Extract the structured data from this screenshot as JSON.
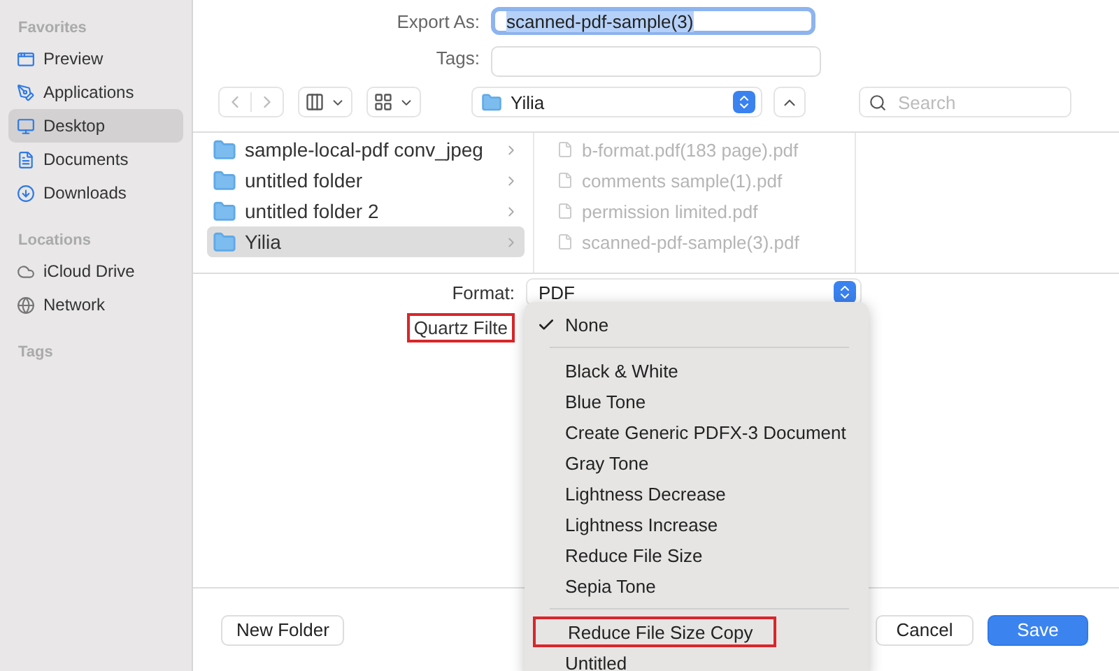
{
  "sidebar": {
    "sections": [
      {
        "heading": "Favorites",
        "items": [
          {
            "label": "Preview",
            "selected": false
          },
          {
            "label": "Applications",
            "selected": false
          },
          {
            "label": "Desktop",
            "selected": true
          },
          {
            "label": "Documents",
            "selected": false
          },
          {
            "label": "Downloads",
            "selected": false
          }
        ]
      },
      {
        "heading": "Locations",
        "items": [
          {
            "label": "iCloud Drive",
            "selected": false
          },
          {
            "label": "Network",
            "selected": false
          }
        ]
      },
      {
        "heading": "Tags"
      }
    ]
  },
  "export_as": {
    "label": "Export As:",
    "value": "scanned-pdf-sample(3)"
  },
  "tags": {
    "label": "Tags:"
  },
  "toolbar": {
    "location": "Yilia",
    "search_placeholder": "Search"
  },
  "browser": {
    "column_1": [
      {
        "name": "sample-local-pdf conv_jpeg",
        "selected": false
      },
      {
        "name": "untitled folder",
        "selected": false
      },
      {
        "name": "untitled folder 2",
        "selected": false
      },
      {
        "name": "Yilia",
        "selected": true
      }
    ],
    "column_2": [
      {
        "name": "b-format.pdf(183 page).pdf",
        "disabled": true
      },
      {
        "name": "comments sample(1).pdf",
        "disabled": true
      },
      {
        "name": "permission limited.pdf",
        "disabled": true
      },
      {
        "name": "scanned-pdf-sample(3).pdf",
        "disabled": true
      }
    ]
  },
  "format": {
    "label": "Format:",
    "value": "PDF"
  },
  "quartz_filter": {
    "label": "Quartz Filte",
    "annotated": true
  },
  "filter_menu": [
    {
      "label": "None",
      "checked": true,
      "annotated": false,
      "kind": "item"
    },
    {
      "kind": "separator"
    },
    {
      "label": "Black & White",
      "checked": false,
      "annotated": false,
      "kind": "item"
    },
    {
      "label": "Blue Tone",
      "checked": false,
      "annotated": false,
      "kind": "item"
    },
    {
      "label": "Create Generic PDFX-3 Document",
      "checked": false,
      "annotated": false,
      "kind": "item"
    },
    {
      "label": "Gray Tone",
      "checked": false,
      "annotated": false,
      "kind": "item"
    },
    {
      "label": "Lightness Decrease",
      "checked": false,
      "annotated": false,
      "kind": "item"
    },
    {
      "label": "Lightness Increase",
      "checked": false,
      "annotated": false,
      "kind": "item"
    },
    {
      "label": "Reduce File Size",
      "checked": false,
      "annotated": false,
      "kind": "item"
    },
    {
      "label": "Sepia Tone",
      "checked": false,
      "annotated": false,
      "kind": "item"
    },
    {
      "kind": "separator"
    },
    {
      "label": "Reduce File Size Copy",
      "checked": false,
      "annotated": true,
      "kind": "item"
    },
    {
      "label": "Untitled",
      "checked": false,
      "annotated": false,
      "kind": "item"
    }
  ],
  "buttons": {
    "new_folder": "New Folder",
    "cancel": "Cancel",
    "save": "Save"
  }
}
